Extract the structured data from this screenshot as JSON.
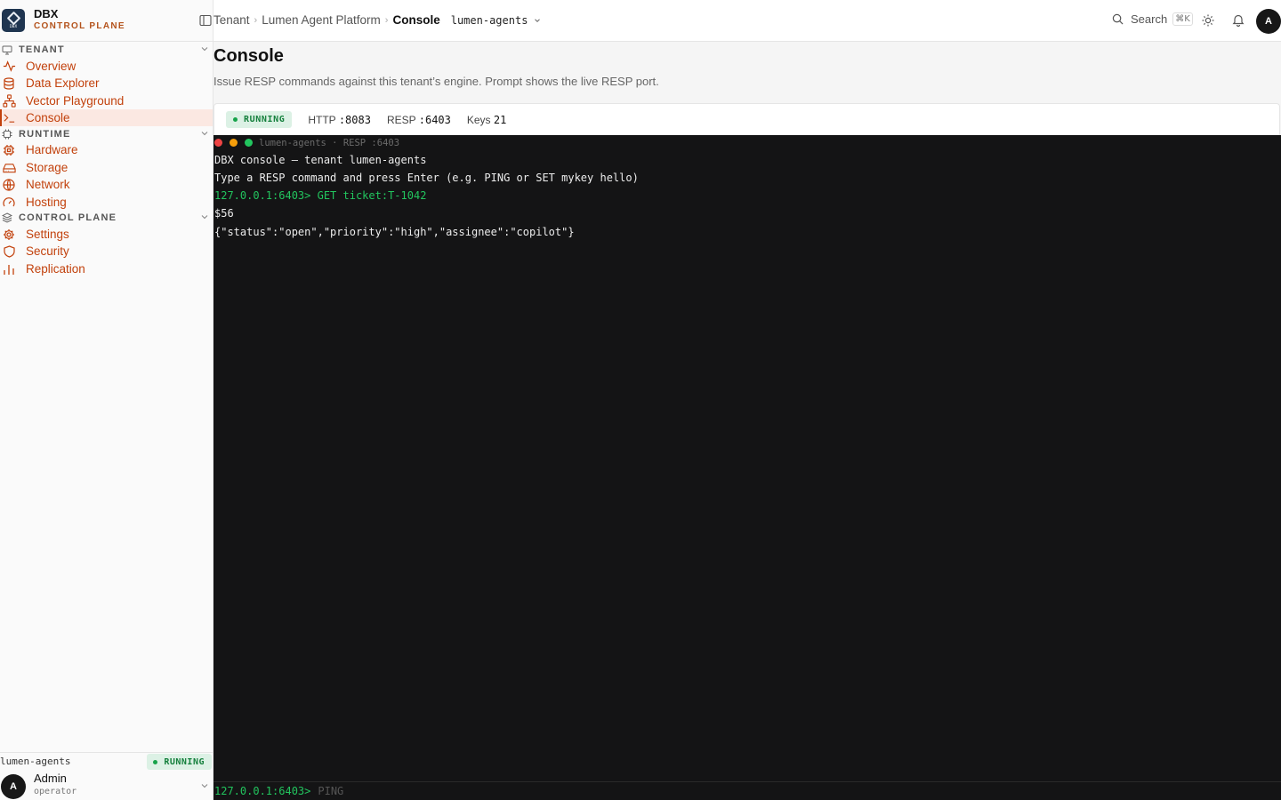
{
  "brand": {
    "name": "DBX",
    "subtitle": "CONTROL PLANE",
    "logo_text": "DBX"
  },
  "sidebar": {
    "sections": [
      {
        "label": "TENANT",
        "items": [
          {
            "label": "Overview",
            "icon": "activity-icon"
          },
          {
            "label": "Data Explorer",
            "icon": "database-icon"
          },
          {
            "label": "Vector Playground",
            "icon": "network-nodes-icon"
          },
          {
            "label": "Console",
            "icon": "terminal-icon",
            "active": true
          }
        ]
      },
      {
        "label": "RUNTIME",
        "items": [
          {
            "label": "Hardware",
            "icon": "cpu-icon"
          },
          {
            "label": "Storage",
            "icon": "hard-drive-icon"
          },
          {
            "label": "Network",
            "icon": "globe-icon"
          },
          {
            "label": "Hosting",
            "icon": "gauge-icon"
          }
        ]
      },
      {
        "label": "CONTROL PLANE",
        "items": [
          {
            "label": "Settings",
            "icon": "gear-icon"
          },
          {
            "label": "Security",
            "icon": "shield-icon"
          },
          {
            "label": "Replication",
            "icon": "bar-chart-icon"
          }
        ]
      }
    ],
    "footer": {
      "tenant": "lumen-agents",
      "status": "RUNNING",
      "user_name": "Admin",
      "user_role": "operator",
      "avatar_initial": "A"
    }
  },
  "header": {
    "breadcrumbs": [
      "Tenant",
      "Lumen Agent Platform",
      "Console"
    ],
    "tenant_select": "lumen-agents",
    "search_label": "Search",
    "search_shortcut": "⌘K",
    "avatar_initial": "A"
  },
  "page": {
    "title": "Console",
    "subtitle": "Issue RESP commands against this tenant’s engine. Prompt shows the live RESP port."
  },
  "status_bar": {
    "status": "RUNNING",
    "http_label": "HTTP",
    "http_port": ":8083",
    "resp_label": "RESP",
    "resp_port": ":6403",
    "keys_label": "Keys",
    "keys_count": "21"
  },
  "terminal": {
    "title": "lumen-agents · RESP :6403",
    "lines": [
      {
        "text": "DBX console — tenant lumen-agents",
        "kind": "output"
      },
      {
        "text": "Type a RESP command and press Enter (e.g. PING or SET mykey hello)",
        "kind": "output"
      },
      {
        "text": "127.0.0.1:6403> GET ticket:T-1042",
        "kind": "command"
      },
      {
        "text": "$56",
        "kind": "output"
      },
      {
        "text": "{\"status\":\"open\",\"priority\":\"high\",\"assignee\":\"copilot\"}",
        "kind": "output"
      }
    ],
    "prompt": "127.0.0.1:6403>",
    "input_placeholder": "PING",
    "colors": {
      "background": "#141415",
      "prompt": "#22c55e",
      "close": "#ef4444",
      "minimize": "#f59e0b",
      "maximize": "#22c55e"
    }
  },
  "colors": {
    "accent": "#c2410c",
    "running": "#15803d"
  }
}
